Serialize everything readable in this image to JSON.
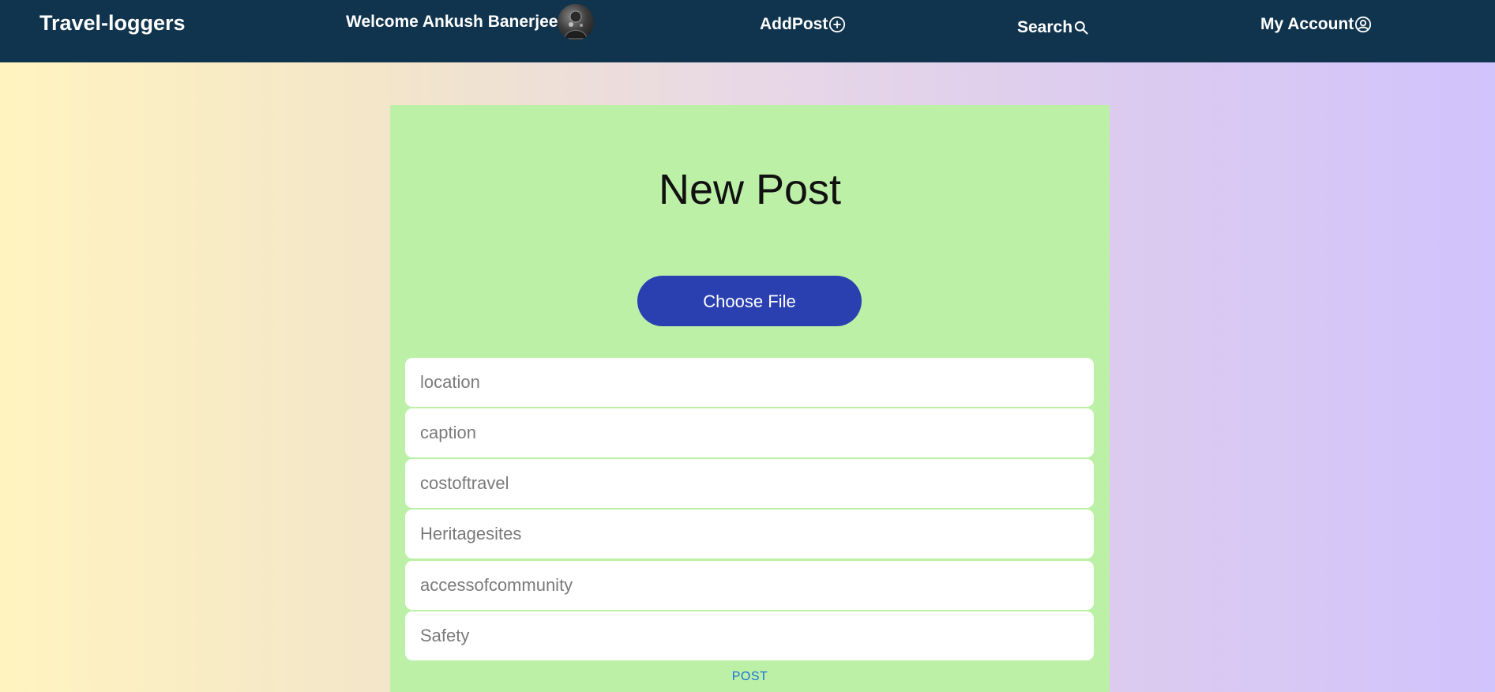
{
  "navbar": {
    "brand": "Travel-loggers",
    "welcome_text": "Welcome Ankush Banerjee",
    "addpost_label": "AddPost",
    "search_label": "Search",
    "account_label": "My Account",
    "icons": {
      "addpost": "plus-circle-icon",
      "search": "search-icon",
      "account": "user-circle-icon",
      "avatar": "user-avatar"
    },
    "background_color": "#10344d"
  },
  "card": {
    "title": "New Post",
    "choose_file_label": "Choose File",
    "fields": [
      {
        "placeholder": "location"
      },
      {
        "placeholder": "caption"
      },
      {
        "placeholder": "costoftravel"
      },
      {
        "placeholder": "Heritagesites"
      },
      {
        "placeholder": "accessofcommunity"
      },
      {
        "placeholder": "Safety"
      }
    ],
    "post_label": "POST",
    "background_color": "#bdf0a7",
    "button_color": "#2a40b0"
  }
}
